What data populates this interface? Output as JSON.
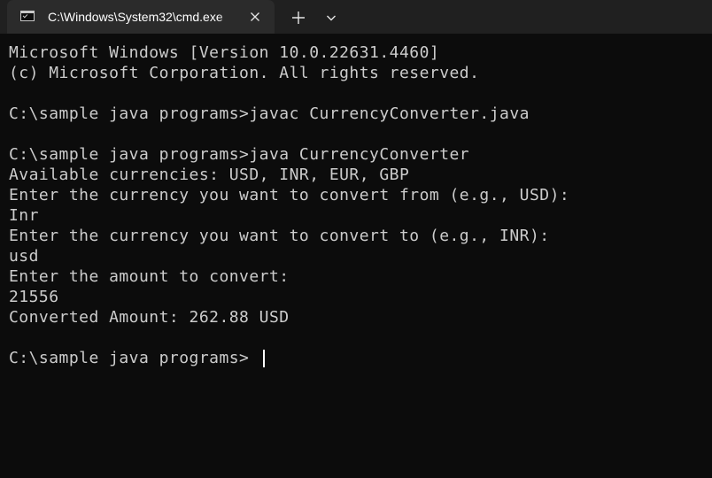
{
  "tab": {
    "title": "C:\\Windows\\System32\\cmd.exe",
    "icon": "cmd-icon",
    "close_icon": "close-icon"
  },
  "toolbar": {
    "new_tab_icon": "plus-icon",
    "dropdown_icon": "chevron-down-icon"
  },
  "console": {
    "lines": [
      "Microsoft Windows [Version 10.0.22631.4460]",
      "(c) Microsoft Corporation. All rights reserved.",
      "",
      "C:\\sample java programs>javac CurrencyConverter.java",
      "",
      "C:\\sample java programs>java CurrencyConverter",
      "Available currencies: USD, INR, EUR, GBP",
      "Enter the currency you want to convert from (e.g., USD):",
      "Inr",
      "Enter the currency you want to convert to (e.g., INR):",
      "usd",
      "Enter the amount to convert:",
      "21556",
      "Converted Amount: 262.88 USD",
      "",
      "C:\\sample java programs>"
    ]
  },
  "colors": {
    "console_bg": "#0c0c0c",
    "console_fg": "#cccccc",
    "titlebar_bg": "#202020",
    "active_tab_bg": "#2b2b2b"
  }
}
